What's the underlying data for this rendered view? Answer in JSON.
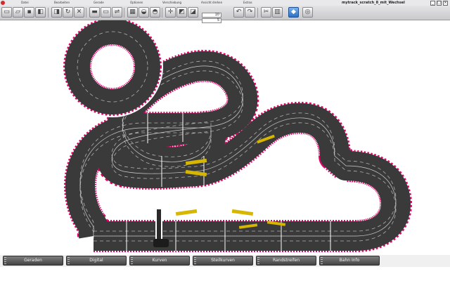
{
  "window": {
    "title": "mytrack_scratch_8_mit_Wechsel",
    "minimize_label": "_",
    "maximize_label": "□",
    "close_label": "×"
  },
  "toolbar": {
    "groups": [
      "Datei",
      "Bearbeiten",
      "Gerade",
      "Optionen",
      "Verschiebung",
      "Ansicht drehen",
      "Extras"
    ],
    "zoom": {
      "value_top": "10",
      "value_bottom": "5"
    }
  },
  "bottom_tabs": [
    "Geraden",
    "Digital",
    "Kurven",
    "Steilkurven",
    "Randstreifen",
    "Bahn Info"
  ],
  "colors": {
    "track_surface": "#3a3a3a",
    "border_red": "#e8006a",
    "lane_line": "#ffffff",
    "active_tool": "#2c6fc4"
  }
}
